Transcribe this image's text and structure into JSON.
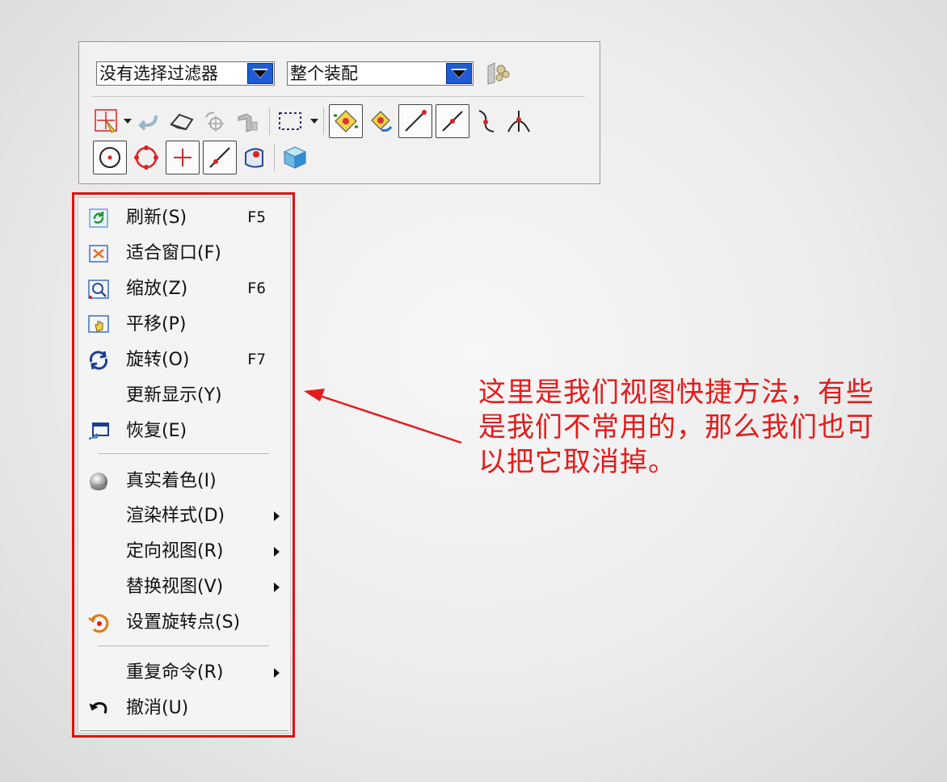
{
  "toolbar": {
    "filter_combo": {
      "value": "没有选择过滤器"
    },
    "scope_combo": {
      "value": "整个装配"
    },
    "colors": {
      "combo_button": "#1f5bd6",
      "annotation_red": "#e41b1b"
    }
  },
  "menu": {
    "groups": [
      {
        "items": [
          {
            "id": "refresh",
            "label": "刷新(S)",
            "shortcut": "F5",
            "icon": "refresh-icon",
            "submenu": false
          },
          {
            "id": "fit",
            "label": "适合窗口(F)",
            "shortcut": "",
            "icon": "fit-window-icon",
            "submenu": false
          },
          {
            "id": "zoom",
            "label": "缩放(Z)",
            "shortcut": "F6",
            "icon": "zoom-icon",
            "submenu": false
          },
          {
            "id": "pan",
            "label": "平移(P)",
            "shortcut": "",
            "icon": "pan-icon",
            "submenu": false
          },
          {
            "id": "rotate",
            "label": "旋转(O)",
            "shortcut": "F7",
            "icon": "rotate-icon",
            "submenu": false
          },
          {
            "id": "update-display",
            "label": "更新显示(Y)",
            "shortcut": "",
            "icon": "",
            "submenu": false
          },
          {
            "id": "restore",
            "label": "恢复(E)",
            "shortcut": "",
            "icon": "restore-icon",
            "submenu": false
          }
        ]
      },
      {
        "items": [
          {
            "id": "true-shading",
            "label": "真实着色(I)",
            "shortcut": "",
            "icon": "true-shading-icon",
            "submenu": false
          },
          {
            "id": "render-style",
            "label": "渲染样式(D)",
            "shortcut": "",
            "icon": "",
            "submenu": true
          },
          {
            "id": "orient-view",
            "label": "定向视图(R)",
            "shortcut": "",
            "icon": "",
            "submenu": true
          },
          {
            "id": "replace-view",
            "label": "替换视图(V)",
            "shortcut": "",
            "icon": "",
            "submenu": true
          },
          {
            "id": "set-rotation-point",
            "label": "设置旋转点(S)",
            "shortcut": "",
            "icon": "rotation-point-icon",
            "submenu": false
          }
        ]
      },
      {
        "items": [
          {
            "id": "repeat-command",
            "label": "重复命令(R)",
            "shortcut": "",
            "icon": "",
            "submenu": true
          },
          {
            "id": "undo",
            "label": "撤消(U)",
            "shortcut": "",
            "icon": "undo-icon",
            "submenu": false
          }
        ]
      }
    ]
  },
  "annotation": {
    "text_lines": [
      "这里是我们视图快捷方法，有些",
      "是我们不常用的，那么我们也可",
      "以把它取消掉。"
    ]
  }
}
